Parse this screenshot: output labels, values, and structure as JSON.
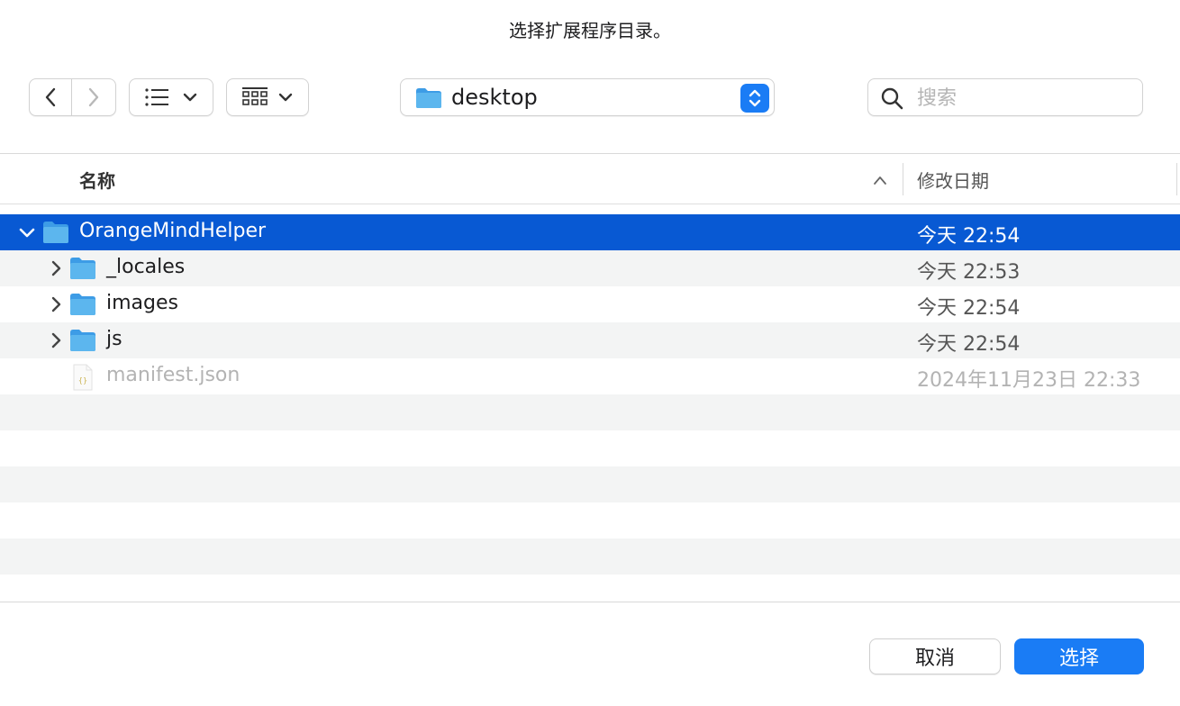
{
  "dialog": {
    "title": "选择扩展程序目录。"
  },
  "toolbar": {
    "path_label": "desktop",
    "search_placeholder": "搜索",
    "list_view_icon": "list-icon",
    "grid_view_icon": "grid-icon"
  },
  "columns": {
    "name": "名称",
    "date": "修改日期"
  },
  "files": [
    {
      "name": "OrangeMindHelper",
      "date": "今天 22:54",
      "type": "folder",
      "expanded": true,
      "selected": true,
      "level": 0
    },
    {
      "name": "_locales",
      "date": "今天 22:53",
      "type": "folder",
      "expanded": false,
      "selected": false,
      "level": 1
    },
    {
      "name": "images",
      "date": "今天 22:54",
      "type": "folder",
      "expanded": false,
      "selected": false,
      "level": 1
    },
    {
      "name": "js",
      "date": "今天 22:54",
      "type": "folder",
      "expanded": false,
      "selected": false,
      "level": 1
    },
    {
      "name": "manifest.json",
      "date": "2024年11月23日 22:33",
      "type": "json-file",
      "dimmed": true,
      "level": 1
    }
  ],
  "buttons": {
    "cancel": "取消",
    "choose": "选择"
  },
  "colors": {
    "accent": "#1a7cf5",
    "selection": "#0859d3",
    "folder": "#5cb6ee"
  }
}
